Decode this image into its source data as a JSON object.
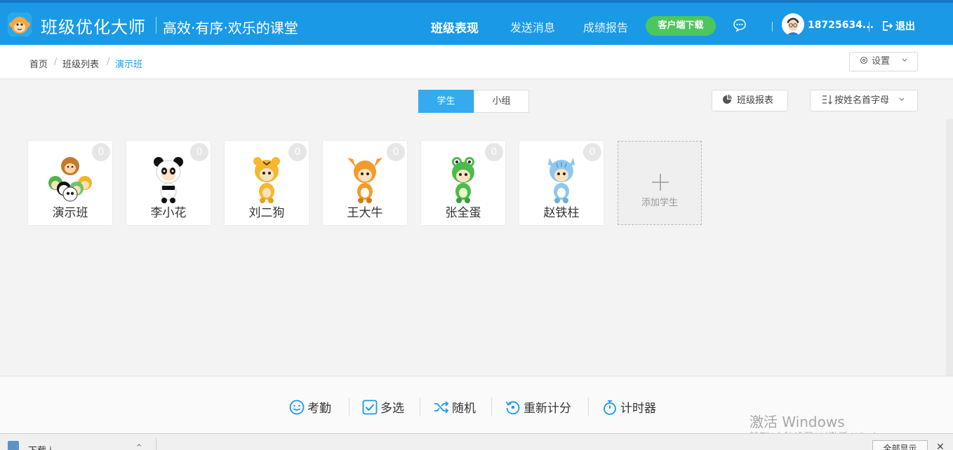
{
  "header": {
    "app_name": "班级优化大师",
    "slogan": "高效·有序·欢乐的课堂",
    "nav": [
      {
        "label": "班级表现",
        "active": true
      },
      {
        "label": "发送消息",
        "active": false
      },
      {
        "label": "成绩报告",
        "active": false
      }
    ],
    "download_label": "客户端下载",
    "username": "18725634...",
    "logout_label": "退出",
    "accent_color": "#1a9ae6"
  },
  "breadcrumb": {
    "items": [
      "首页",
      "班级列表",
      "演示班"
    ],
    "separator": "/"
  },
  "settings_label": "设置",
  "tabs": {
    "students": "学生",
    "groups": "小组",
    "active": "students"
  },
  "report_label": "班级报表",
  "sort_label": "按姓名首字母",
  "students": [
    {
      "name": "演示班",
      "score": "0",
      "avatar": "group-monkey-avatar-icon"
    },
    {
      "name": "李小花",
      "score": "0",
      "avatar": "panda-avatar-icon"
    },
    {
      "name": "刘二狗",
      "score": "0",
      "avatar": "tiger-avatar-icon"
    },
    {
      "name": "王大牛",
      "score": "0",
      "avatar": "deer-avatar-icon"
    },
    {
      "name": "张全蛋",
      "score": "0",
      "avatar": "frog-avatar-icon"
    },
    {
      "name": "赵铁柱",
      "score": "0",
      "avatar": "cat-avatar-icon"
    }
  ],
  "add_student_label": "添加学生",
  "toolbar": {
    "attendance": "考勤",
    "multi_select": "多选",
    "random": "随机",
    "reset_score": "重新计分",
    "timer": "计时器"
  },
  "watermark": {
    "line1": "激活 Windows",
    "line2": "转到“电脑设置”以激活 Windows。"
  },
  "download_bar": {
    "file_label": "下载 j",
    "show_all": "全部显示",
    "close": "✕"
  }
}
